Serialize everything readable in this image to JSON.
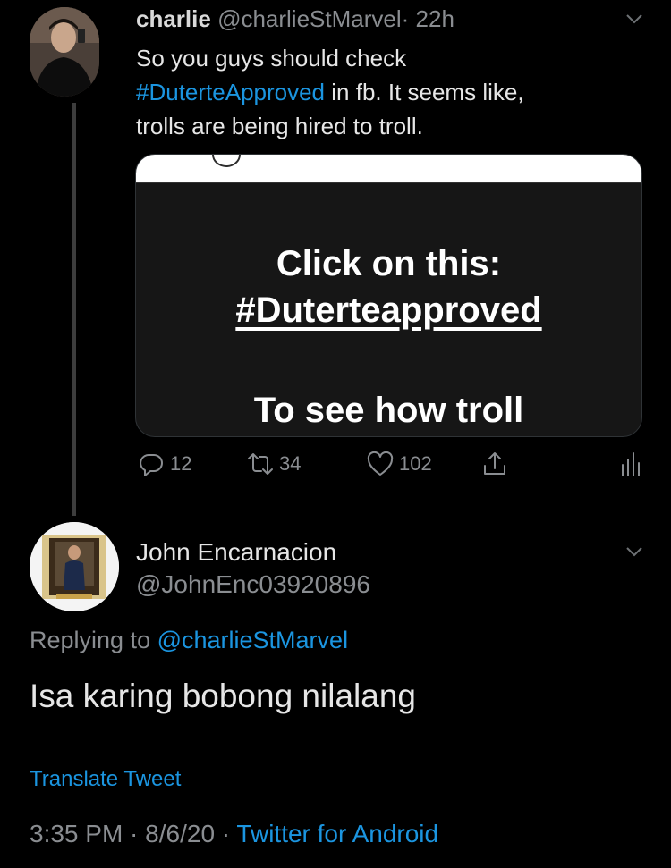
{
  "tweet1": {
    "name": "charlie",
    "handle": "@charlieStMarvel",
    "separator": "·",
    "time": "22h",
    "text_line1": "So you guys should check",
    "hashtag": "#DuterteApproved",
    "text_line2_rest": " in fb. It seems like,",
    "text_line3": "trolls are being hired to troll.",
    "card": {
      "line1": "Click on this:",
      "line2": "#Duterteapproved",
      "line3": "To see how troll"
    },
    "actions": {
      "replies": "12",
      "retweets": "34",
      "likes": "102"
    }
  },
  "tweet2": {
    "name": "John Encarnacion",
    "handle": "@JohnEnc03920896",
    "replying_prefix": "Replying to ",
    "replying_mention": "@charlieStMarvel",
    "text": "Isa karing bobong nilalang",
    "translate_label": "Translate Tweet",
    "time": "3:35 PM",
    "sep1": " · ",
    "date": "8/6/20",
    "sep2": " · ",
    "source": "Twitter for Android"
  },
  "icons": [
    "chevron-down-icon",
    "reply-icon",
    "retweet-icon",
    "like-icon",
    "share-icon",
    "analytics-icon"
  ],
  "colors": {
    "background": "#000000",
    "accent": "#1b95e0",
    "secondary_text": "#8a8d91"
  }
}
